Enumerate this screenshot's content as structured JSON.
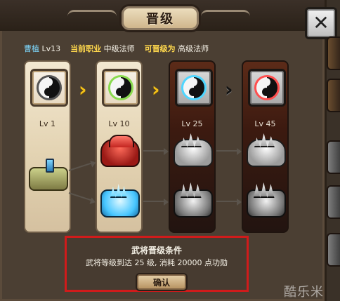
{
  "dialog": {
    "title": "晋级",
    "close_glyph": "✕"
  },
  "header": {
    "name": "曹植",
    "level": "Lv13",
    "current_job_label": "当前职业",
    "current_job_value": "中级法师",
    "promote_label": "可晋级为",
    "promote_value": "高级法师"
  },
  "tiers": [
    {
      "level_label": "Lv 1",
      "state": "current"
    },
    {
      "level_label": "Lv 10",
      "state": "current"
    },
    {
      "level_label": "Lv 25",
      "state": "locked"
    },
    {
      "level_label": "Lv 45",
      "state": "locked"
    }
  ],
  "conditions": {
    "title": "武将晋级条件",
    "text": "武将等级到达 25 级, 消耗 20000 点功勋",
    "confirm_label": "确认"
  },
  "watermark": {
    "text": "酷乐米"
  },
  "colors": {
    "name_blue": "#7ed9ff",
    "label_gold": "#ffd84d",
    "highlight_red": "#d01b1b"
  }
}
